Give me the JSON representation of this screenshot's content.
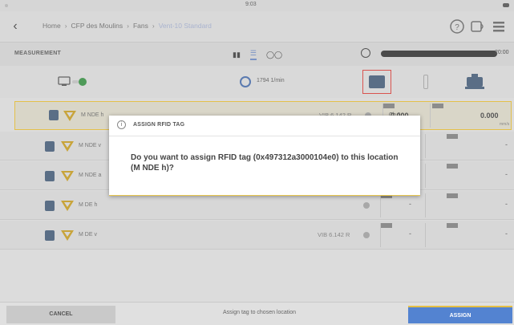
{
  "statusbar": {
    "time": "9:03"
  },
  "breadcrumb": {
    "items": [
      "Home",
      "CFP des Moulins",
      "Fans",
      "Vent-10 Standard"
    ]
  },
  "measurement_bar": {
    "title": "MEASUREMENT",
    "progress_label": "20:00",
    "progress_value": 1.0
  },
  "toolbar": {
    "speed": "1794 1/min"
  },
  "rows": [
    {
      "name": "M NDE h",
      "channel": "Ch 1",
      "sensor": "VIB 6.142 R",
      "value1": "0.000",
      "value2": "0.000"
    },
    {
      "name": "M NDE v",
      "channel": "",
      "sensor": "",
      "value1": "-",
      "value2": "-"
    },
    {
      "name": "M NDE a",
      "channel": "",
      "sensor": "",
      "value1": "-",
      "value2": "-"
    },
    {
      "name": "M DE h",
      "channel": "",
      "sensor": "",
      "value1": "-",
      "value2": "-"
    },
    {
      "name": "M DE v",
      "channel": "",
      "sensor": "VIB 6.142 R",
      "value1": "-",
      "value2": "-"
    }
  ],
  "dialog": {
    "title": "ASSIGN RFID TAG",
    "message": "Do you want to assign RFID tag (0x497312a3000104e0) to this location (M NDE h)?"
  },
  "bottom": {
    "cancel_label": "CANCEL",
    "hint": "Assign tag to chosen location",
    "assign_label": "ASSIGN"
  },
  "colors": {
    "accent": "#5383d1",
    "highlight": "#e4c04a",
    "status_ok": "#4e9a58",
    "selection_box": "#d9534f"
  },
  "icons": {
    "back": "chevron-left-icon",
    "help": "help-icon",
    "tag": "rfid-tag-icon",
    "menu": "menu-icon"
  }
}
